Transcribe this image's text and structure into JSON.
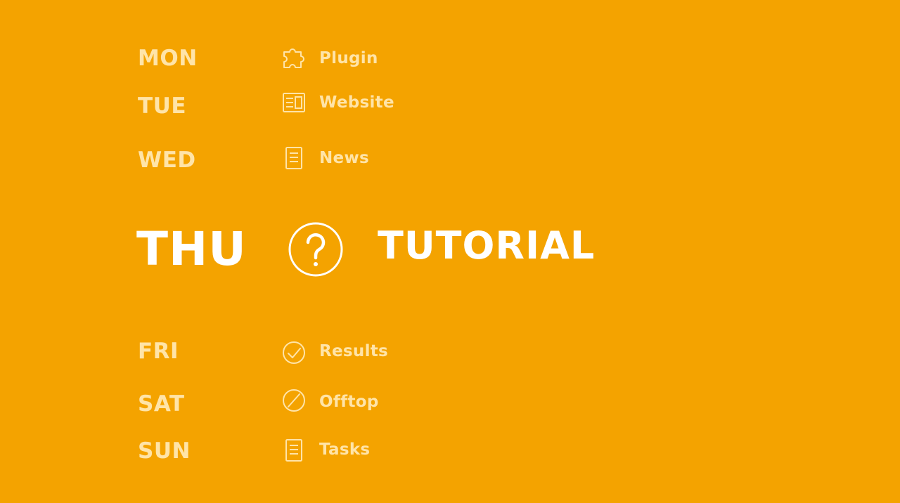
{
  "colors": {
    "background": "#F4A300",
    "muted_text": "#FFE4A8",
    "featured_text": "#FFFFFF"
  },
  "schedule": [
    {
      "day": "MON",
      "label": "Plugin",
      "icon": "puzzle-piece-icon"
    },
    {
      "day": "TUE",
      "label": "Website",
      "icon": "webpage-layout-icon"
    },
    {
      "day": "WED",
      "label": "News",
      "icon": "document-lines-icon"
    },
    {
      "day": "THU",
      "label": "TUTORIAL",
      "icon": "question-circle-icon",
      "featured": true
    },
    {
      "day": "FRI",
      "label": "Results",
      "icon": "check-circle-icon"
    },
    {
      "day": "SAT",
      "label": "Offtop",
      "icon": "slash-circle-icon"
    },
    {
      "day": "SUN",
      "label": "Tasks",
      "icon": "document-lines-icon"
    }
  ]
}
